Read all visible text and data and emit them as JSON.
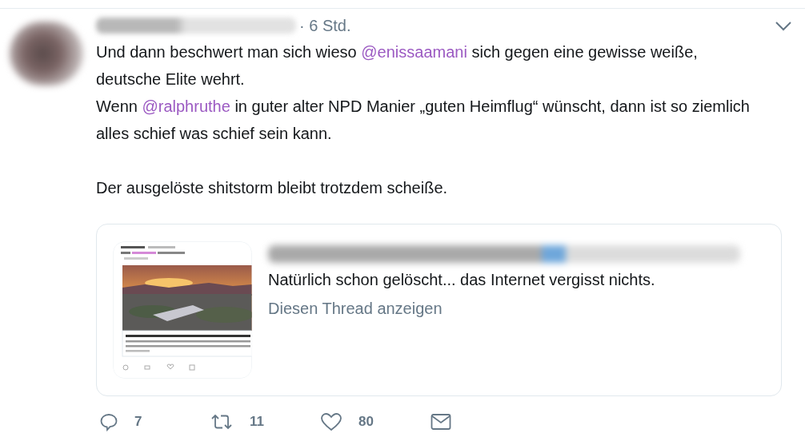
{
  "tweet": {
    "time": "· 6 Std.",
    "paragraphs": [
      [
        {
          "kind": "text",
          "text": "Und dann beschwert man sich wieso "
        },
        {
          "kind": "mention",
          "text": "@enissaamani"
        },
        {
          "kind": "text",
          "text": " sich gegen eine gewisse weiße, deutsche Elite wehrt."
        },
        {
          "kind": "break"
        },
        {
          "kind": "text",
          "text": "Wenn "
        },
        {
          "kind": "mention",
          "text": "@ralphruthe"
        },
        {
          "kind": "text",
          "text": " in guter alter NPD Manier „guten Heimflug“ wünscht, dann ist so ziemlich alles schief was schief sein kann."
        }
      ],
      [
        {
          "kind": "text",
          "text": "Der ausgelöste shitstorm bleibt trotzdem scheiße."
        }
      ]
    ],
    "quote": {
      "text": "Natürlich schon gelöscht... das Internet vergisst nichts.",
      "link": "Diesen Thread anzeigen"
    },
    "actions": [
      {
        "kind": "reply",
        "count": "7"
      },
      {
        "kind": "retweet",
        "count": "11"
      },
      {
        "kind": "like",
        "count": "80"
      },
      {
        "kind": "message"
      }
    ]
  }
}
